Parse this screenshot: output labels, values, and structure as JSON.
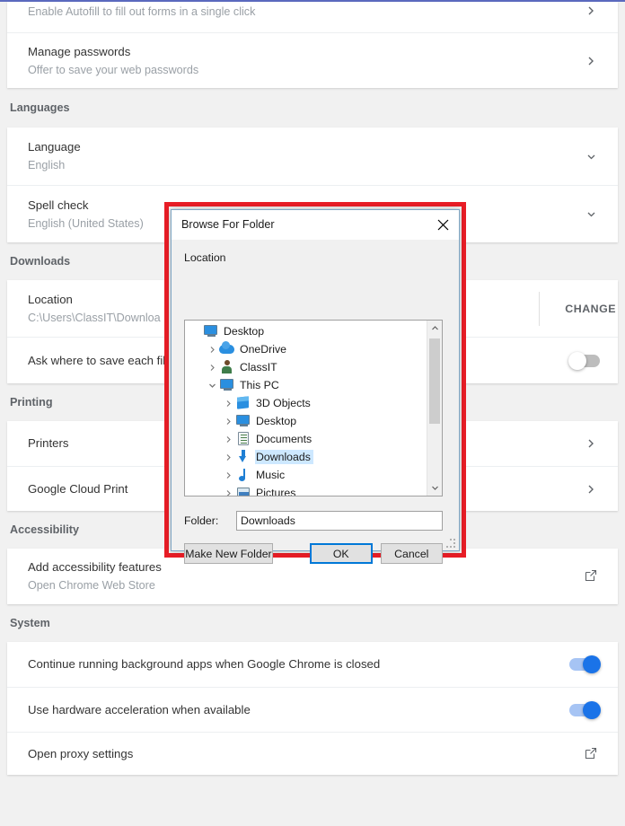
{
  "settings": {
    "partial_top_row": {
      "title": "",
      "sub": "Enable Autofill to fill out forms in a single click"
    },
    "autofill_card": {
      "manage_passwords": {
        "title": "Manage passwords",
        "sub": "Offer to save your web passwords",
        "arrow": "chevron-right-icon"
      }
    },
    "languages": {
      "header": "Languages",
      "rows": [
        {
          "title": "Language",
          "sub": "English",
          "arrow": "chevron-down-icon"
        },
        {
          "title": "Spell check",
          "sub": "English (United States)",
          "arrow": "chevron-down-icon"
        }
      ]
    },
    "downloads": {
      "header": "Downloads",
      "location": {
        "title": "Location",
        "sub": "C:\\Users\\ClassIT\\Downloa",
        "change_label": "CHANGE"
      },
      "ask_each_file": {
        "title": "Ask where to save each file",
        "toggle_on": false
      }
    },
    "printing": {
      "header": "Printing",
      "rows": [
        {
          "title": "Printers",
          "arrow": "chevron-right-icon"
        },
        {
          "title": "Google Cloud Print",
          "arrow": "chevron-right-icon"
        }
      ]
    },
    "accessibility": {
      "header": "Accessibility",
      "row": {
        "title": "Add accessibility features",
        "sub": "Open Chrome Web Store",
        "icon": "external-link-icon"
      }
    },
    "system": {
      "header": "System",
      "rows": [
        {
          "title": "Continue running background apps when Google Chrome is closed",
          "toggle_on": true
        },
        {
          "title": "Use hardware acceleration when available",
          "toggle_on": true
        },
        {
          "title": "Open proxy settings",
          "icon": "external-link-icon"
        }
      ]
    }
  },
  "highlight": {
    "color": "#e81d26"
  },
  "dialog": {
    "title": "Browse For Folder",
    "close_icon": "close-icon",
    "location_label": "Location",
    "tree": [
      {
        "label": "Desktop",
        "indent": 0,
        "twisty": "none",
        "icon": "monitor-icon",
        "selected": false
      },
      {
        "label": "OneDrive",
        "indent": 1,
        "twisty": "collapsed",
        "icon": "cloud-icon",
        "selected": false
      },
      {
        "label": "ClassIT",
        "indent": 1,
        "twisty": "collapsed",
        "icon": "person-icon",
        "selected": false
      },
      {
        "label": "This PC",
        "indent": 1,
        "twisty": "expanded",
        "icon": "monitor-icon",
        "selected": false
      },
      {
        "label": "3D Objects",
        "indent": 2,
        "twisty": "collapsed",
        "icon": "cube-icon",
        "selected": false
      },
      {
        "label": "Desktop",
        "indent": 2,
        "twisty": "collapsed",
        "icon": "monitor-icon",
        "selected": false
      },
      {
        "label": "Documents",
        "indent": 2,
        "twisty": "collapsed",
        "icon": "document-icon",
        "selected": false
      },
      {
        "label": "Downloads",
        "indent": 2,
        "twisty": "collapsed",
        "icon": "download-icon",
        "selected": true
      },
      {
        "label": "Music",
        "indent": 2,
        "twisty": "collapsed",
        "icon": "music-icon",
        "selected": false
      },
      {
        "label": "Pictures",
        "indent": 2,
        "twisty": "collapsed",
        "icon": "picture-icon",
        "selected": false
      }
    ],
    "folder_label": "Folder:",
    "folder_value": "Downloads",
    "buttons": {
      "make_new_folder": "Make New Folder",
      "ok": "OK",
      "cancel": "Cancel"
    }
  }
}
